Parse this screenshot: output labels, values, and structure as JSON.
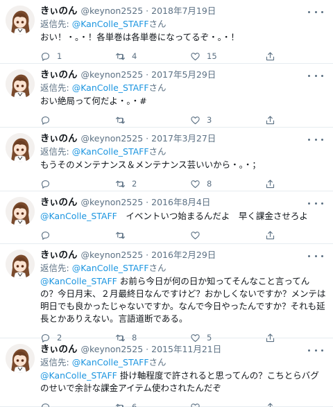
{
  "reply_prefix": "返信先: ",
  "reply_suffix": "さん",
  "separator": "·",
  "tweets": [
    {
      "display_name": "きぃのん",
      "handle": "@keynon2525",
      "date": "2018年7月19日",
      "reply_to": "@KanColle_STAFF",
      "mention": "",
      "text": "おい！・。・！各単巻は各単巻になってるぞ・。・！",
      "replies": "1",
      "retweets": "4",
      "likes": "15"
    },
    {
      "display_name": "きぃのん",
      "handle": "@keynon2525",
      "date": "2017年5月29日",
      "reply_to": "@KanColle_STAFF",
      "mention": "",
      "text": "おい絶局って何だよ・。・#",
      "replies": "",
      "retweets": "",
      "likes": "3"
    },
    {
      "display_name": "きぃのん",
      "handle": "@keynon2525",
      "date": "2017年3月27日",
      "reply_to": "@KanColle_STAFF",
      "mention": "",
      "text": "もうそのメンテナンス＆メンテナンス芸いいから・。・；",
      "replies": "",
      "retweets": "2",
      "likes": "8"
    },
    {
      "display_name": "きぃのん",
      "handle": "@keynon2525",
      "date": "2016年8月4日",
      "reply_to": "",
      "mention": "@KanColle_STAFF",
      "text": "　イベントいつ始まるんだよ　早く課金させろよ",
      "replies": "",
      "retweets": "",
      "likes": ""
    },
    {
      "display_name": "きぃのん",
      "handle": "@keynon2525",
      "date": "2016年2月29日",
      "reply_to": "@KanColle_STAFF",
      "mention": "@KanColle_STAFF",
      "text": " お前ら今日が何の日か知ってそんなこと言ってんの？今日月末、２月最終日なんですけど？おかしくないですか？メンテは明日でも良かったじゃないですか。なんで今日やったんですか？それも延長とかありえない。言語道断である。",
      "replies": "2",
      "retweets": "8",
      "likes": "5"
    },
    {
      "display_name": "きぃのん",
      "handle": "@keynon2525",
      "date": "2015年11月21日",
      "reply_to": "@KanColle_STAFF",
      "mention": "@KanColle_STAFF",
      "text": " 掛け軸程度で許されると思ってんの？こちとらバグのせいで余計な課金アイテム使わされたんだぞ",
      "replies": "",
      "retweets": "6",
      "likes": ""
    }
  ],
  "icons": [
    "avatar-image",
    "more-icon",
    "reply-icon",
    "retweet-icon",
    "like-icon",
    "share-icon"
  ],
  "colors": {
    "link": "#1b95e0",
    "muted": "#5b7083",
    "text": "#0f1419",
    "divider": "#e6ecf0"
  }
}
